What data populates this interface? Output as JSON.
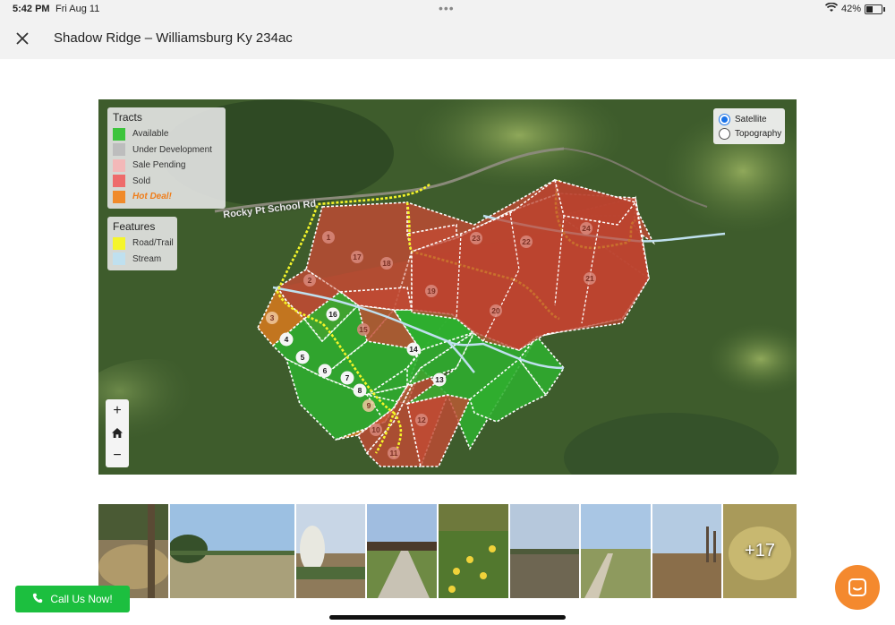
{
  "status_bar": {
    "time": "5:42 PM",
    "date": "Fri Aug 11",
    "dots": "•••",
    "battery_pct": "42%"
  },
  "header": {
    "title": "Shadow Ridge – Williamsburg Ky 234ac"
  },
  "map": {
    "road_label": "Rocky Pt School Rd",
    "tracts_legend": {
      "title": "Tracts",
      "items": [
        {
          "label": "Available",
          "color": "#3cc43c"
        },
        {
          "label": "Under Development",
          "color": "#bdbdbd"
        },
        {
          "label": "Sale Pending",
          "color": "#f3b8b8"
        },
        {
          "label": "Sold",
          "color": "#ee6b6b"
        },
        {
          "label": "Hot Deal!",
          "color": "#f08a2a"
        }
      ]
    },
    "features_legend": {
      "title": "Features",
      "items": [
        {
          "label": "Road/Trail",
          "color": "#f5f52a"
        },
        {
          "label": "Stream",
          "color": "#bfe0ef"
        }
      ]
    },
    "map_types": {
      "satellite": "Satellite",
      "topography": "Topography",
      "selected": "Satellite"
    },
    "zoom": {
      "in": "+",
      "home": "⌂",
      "out": "−"
    },
    "tract_labels": [
      "1",
      "2",
      "3",
      "4",
      "5",
      "6",
      "7",
      "8",
      "9",
      "10",
      "11",
      "12",
      "13",
      "14",
      "15",
      "16",
      "17",
      "18",
      "19",
      "20",
      "21",
      "22",
      "23",
      "24"
    ]
  },
  "gallery": {
    "more_label": "+17"
  },
  "call_button": {
    "label": "Call Us Now!"
  }
}
